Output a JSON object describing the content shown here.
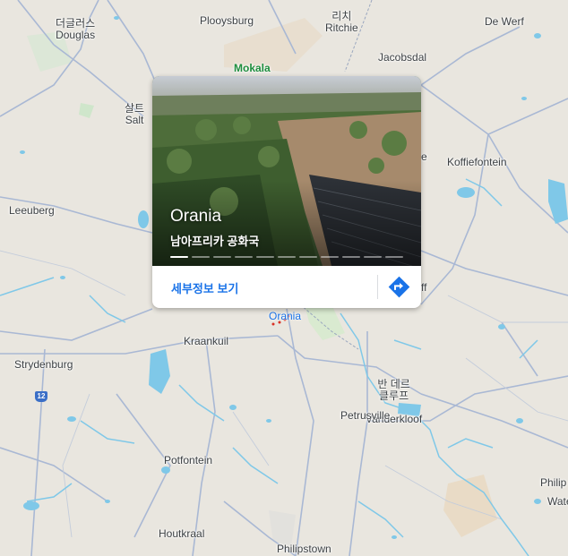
{
  "map": {
    "towns": [
      {
        "id": "douglas",
        "ko": "더글러스",
        "en": "Douglas"
      },
      {
        "id": "plooysburg",
        "ko": "",
        "en": "Plooysburg"
      },
      {
        "id": "ritchie",
        "ko": "리치",
        "en": "Ritchie"
      },
      {
        "id": "dewerf",
        "ko": "",
        "en": "De Werf"
      },
      {
        "id": "jacobsdal",
        "ko": "",
        "en": "Jacobsdal"
      },
      {
        "id": "salt",
        "ko": "살트",
        "en": "Salt"
      },
      {
        "id": "koffiefontein",
        "ko": "",
        "en": "Koffiefontein"
      },
      {
        "id": "leeuberg",
        "ko": "",
        "en": "Leeuberg"
      },
      {
        "id": "kraankuil",
        "ko": "",
        "en": "Kraankuil"
      },
      {
        "id": "strydenburg",
        "ko": "",
        "en": "Strydenburg"
      },
      {
        "id": "vanderkloof",
        "ko": "반 데르\n클루프",
        "en": "Vanderkloof"
      },
      {
        "id": "petrusville",
        "ko": "",
        "en": "Petrusville"
      },
      {
        "id": "potfontein",
        "ko": "",
        "en": "Potfontein"
      },
      {
        "id": "houtkraal",
        "ko": "",
        "en": "Houtkraal"
      },
      {
        "id": "philipstown",
        "ko": "",
        "en": "Philipstown"
      },
      {
        "id": "philip_edge",
        "ko": "",
        "en": "Philip"
      },
      {
        "id": "wate_edge",
        "ko": "",
        "en": "Wate"
      },
      {
        "id": "e_edge",
        "ko": "",
        "en": "e"
      },
      {
        "id": "ff_edge",
        "ko": "",
        "en": "ff"
      }
    ],
    "park": "Mokala",
    "selected_place": "Orania",
    "route_shield": "12"
  },
  "card": {
    "title": "Orania",
    "subtitle": "남아프리카 공화국",
    "details_label": "세부정보 보기",
    "photo_count": 11,
    "active_photo": 1,
    "directions_icon": "directions-icon"
  },
  "colors": {
    "water": "#7fc8e8",
    "road": "#a9b8d4",
    "land": "#e9e6df",
    "link": "#1a73e8"
  }
}
